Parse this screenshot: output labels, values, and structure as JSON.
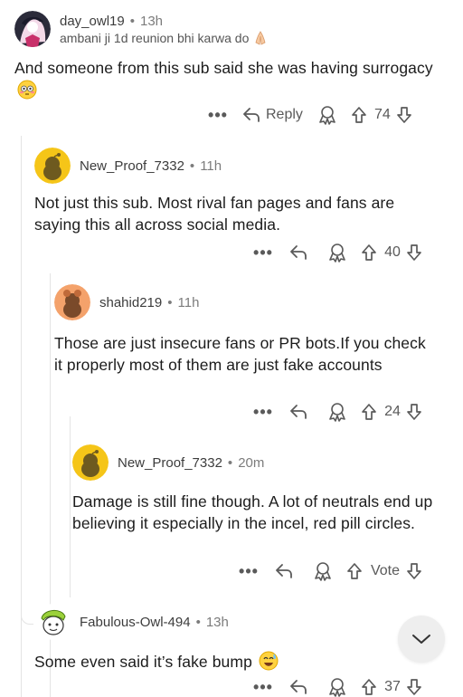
{
  "comments": [
    {
      "username": "day_owl19",
      "time": "13h",
      "flair": "ambani ji 1d reunion bhi karwa do",
      "body": "And someone from this sub said she was having surrogacy",
      "reply_label": "Reply",
      "score": "74"
    },
    {
      "username": "New_Proof_7332",
      "time": "11h",
      "body": "Not just this sub. Most rival fan pages and fans are saying this all across social media.",
      "score": "40"
    },
    {
      "username": "shahid219",
      "time": "11h",
      "body": "Those are just insecure fans or PR bots.If you check it properly most of them are just fake accounts",
      "score": "24"
    },
    {
      "username": "New_Proof_7332",
      "time": "20m",
      "body": "Damage is still fine though. A lot of neutrals end up believing it especially in the incel, red pill circles.",
      "score": "Vote"
    },
    {
      "username": "Fabulous-Owl-494",
      "time": "13h",
      "body": "Some even said it’s fake bump",
      "score": "37"
    }
  ],
  "ui": {
    "dot": "•",
    "more": "•••"
  },
  "colors": {
    "snoo_yellow": "#f5c518",
    "snoo_orange": "#f4a26b",
    "snoo_green": "#9bd13a",
    "meta_gray": "#7c7c7c",
    "action_gray": "#5a5a5a"
  }
}
